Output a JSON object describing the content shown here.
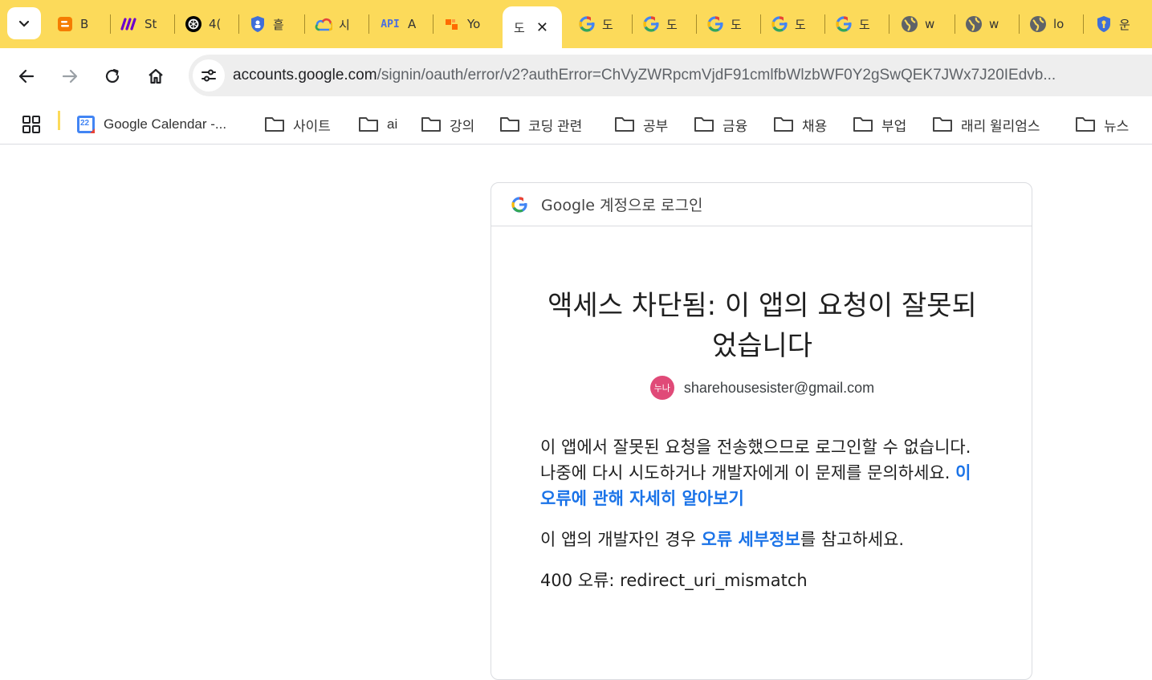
{
  "tabs": [
    {
      "title": "B",
      "icon": "blogger-icon"
    },
    {
      "title": "St",
      "icon": "make-icon"
    },
    {
      "title": "4(",
      "icon": "openai-icon"
    },
    {
      "title": "흩",
      "icon": "shield-icon"
    },
    {
      "title": "시",
      "icon": "google-cloud-icon"
    },
    {
      "title": "A",
      "icon": "api-icon"
    },
    {
      "title": "Yo",
      "icon": "zapier-icon"
    },
    {
      "title": "도",
      "icon": "none",
      "active": true
    },
    {
      "title": "도",
      "icon": "google-g-icon"
    },
    {
      "title": "도",
      "icon": "google-g-icon"
    },
    {
      "title": "도",
      "icon": "google-g-icon"
    },
    {
      "title": "도",
      "icon": "google-g-icon"
    },
    {
      "title": "도",
      "icon": "google-g-icon"
    },
    {
      "title": "w",
      "icon": "globe-icon"
    },
    {
      "title": "w",
      "icon": "globe-icon"
    },
    {
      "title": "lo",
      "icon": "globe-icon"
    },
    {
      "title": "운",
      "icon": "shield-icon"
    }
  ],
  "address": {
    "domain": "accounts.google.com",
    "path": "/signin/oauth/error/v2?authError=ChVyZWRpcmVjdF91cmlfbWlzbWF0Y2gSwQEK7JWx7J20IEdvb..."
  },
  "bookmarks": {
    "calendar_label": "Google Calendar -...",
    "calendar_day": "22",
    "folders": [
      "사이트",
      "ai",
      "강의",
      "코딩 관련",
      "공부",
      "금융",
      "채용",
      "부업",
      "래리 윌리엄스",
      "뉴스"
    ]
  },
  "card": {
    "header": "Google 계정으로 로그인",
    "heading_line1": "액세스 차단됨: 이 앱의 요청이 잘못되",
    "heading_line2": "었습니다",
    "avatar_text": "누나",
    "email": "sharehousesister@gmail.com",
    "p1_text": "이 앱에서 잘못된 요청을 전송했으므로 로그인할 수 없습니다. 나중에 다시 시도하거나 개발자에게 이 문제를 문의하세요. ",
    "p1_link": "이 오류에 관해 자세히 알아보기",
    "p2_prefix": "이 앱의 개발자인 경우 ",
    "p2_link": "오류 세부정보",
    "p2_suffix": "를 참고하세요.",
    "error_code": "400 오류: redirect_uri_mismatch"
  },
  "colors": {
    "tabstrip": "#fcda5a",
    "link": "#1a73e8",
    "avatar": "#e04a78"
  }
}
